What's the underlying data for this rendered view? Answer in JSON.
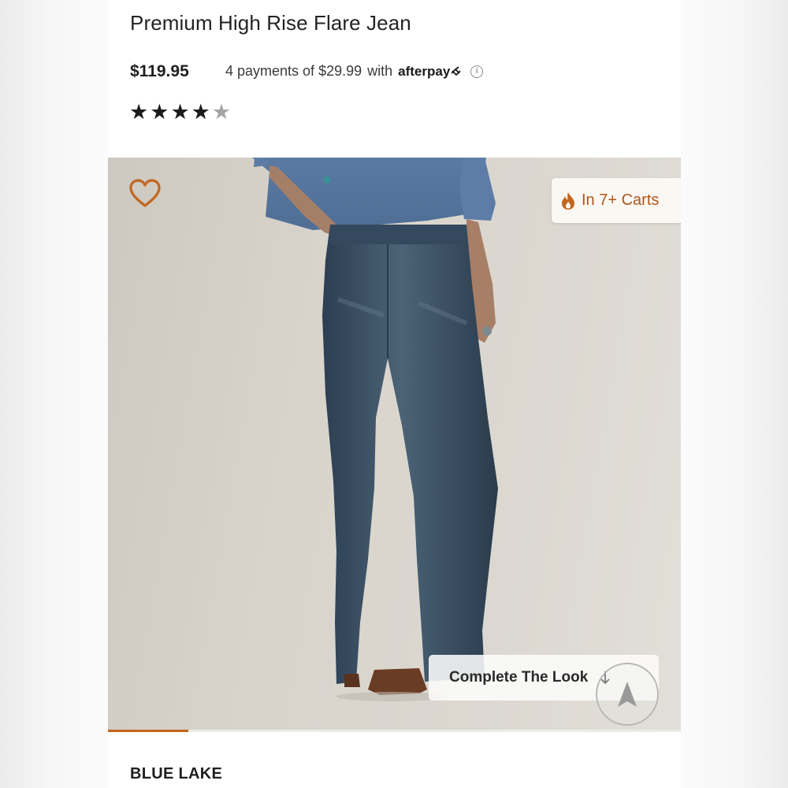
{
  "product": {
    "title": "Premium High Rise Flare Jean",
    "price": "$119.95",
    "installments_text": "4 payments of $29.99",
    "with_text": "with",
    "afterpay_label": "afterpay",
    "rating": {
      "value": 4,
      "max": 5
    },
    "color_name": "BLUE LAKE"
  },
  "hero": {
    "badge_text": "In 7+ Carts",
    "complete_look_label": "Complete The Look",
    "carousel_progress": 0.14
  },
  "icons": {
    "favorite": "heart-outline-icon",
    "badge": "flame-icon",
    "info": "info-icon",
    "afterpay": "afterpay-arrows-icon",
    "down": "arrow-down-icon",
    "nav": "navigation-arrow-icon"
  },
  "colors": {
    "accent": "#c2661e",
    "badge_text": "#b0561a",
    "hero_bg": "#d8d4cc"
  }
}
